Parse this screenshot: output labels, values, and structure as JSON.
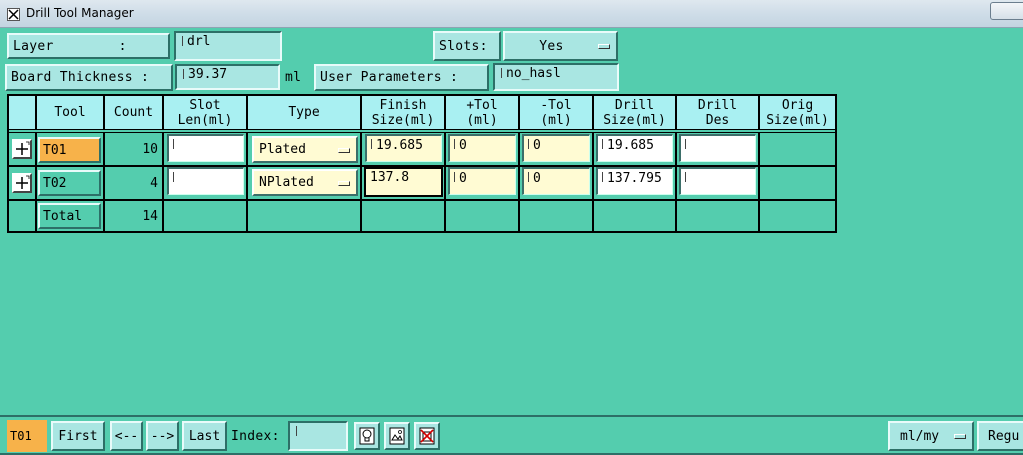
{
  "window": {
    "title": "Drill Tool Manager"
  },
  "header": {
    "layer_label": "Layer        :",
    "layer_value": "drl",
    "slots_label": "Slots:",
    "slots_value": "Yes",
    "thickness_label": "Board Thickness :",
    "thickness_value": "39.37",
    "thickness_unit": "ml",
    "user_params_label": "User Parameters :",
    "user_params_value": "no_hasl"
  },
  "table": {
    "columns": [
      "",
      "Tool",
      "Count",
      "Slot\nLen(ml)",
      "Type",
      "Finish\nSize(ml)",
      "+Tol\n(ml)",
      "-Tol\n(ml)",
      "Drill\nSize(ml)",
      "Drill\nDes",
      "Orig\nSize(ml)"
    ],
    "rows": [
      {
        "tool": "T01",
        "count": "10",
        "slot_len": "",
        "type": "Plated",
        "finish_size": "19.685",
        "plus_tol": "0",
        "minus_tol": "0",
        "drill_size": "19.685",
        "drill_des": "",
        "orig_size": ""
      },
      {
        "tool": "T02",
        "count": "4",
        "slot_len": "",
        "type": "NPlated",
        "finish_size": "137.8",
        "plus_tol": "0",
        "minus_tol": "0",
        "drill_size": "137.795",
        "drill_des": "",
        "orig_size": ""
      }
    ],
    "total_label": "Total",
    "total_count": "14"
  },
  "footer": {
    "current_tool": "T01",
    "first_label": "First",
    "prev_label": "<--",
    "next_label": "-->",
    "last_label": "Last",
    "index_label": "Index:",
    "index_value": "",
    "units_value": "ml/my",
    "regular_label": "Regu"
  },
  "colors": {
    "background": "#54cdae",
    "header_cell": "#a9f0f2",
    "selected_tool": "#f7b24a",
    "input_yellow": "#fffbd3"
  }
}
